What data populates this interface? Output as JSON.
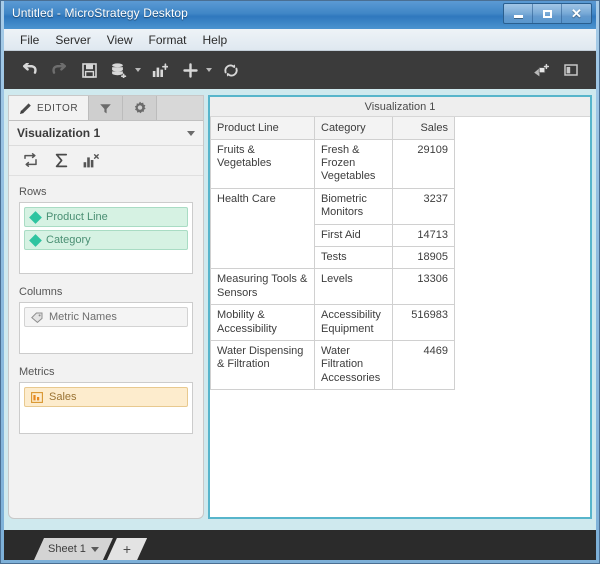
{
  "window": {
    "title": "Untitled - MicroStrategy Desktop",
    "buttons": {
      "minimize": "minimize",
      "maximize": "maximize",
      "close": "close"
    }
  },
  "menubar": {
    "items": [
      {
        "label": "File"
      },
      {
        "label": "Server"
      },
      {
        "label": "View"
      },
      {
        "label": "Format"
      },
      {
        "label": "Help"
      }
    ]
  },
  "toolbar": {
    "buttons": [
      {
        "name": "undo",
        "icon": "undo-arrow-icon",
        "enabled": true
      },
      {
        "name": "redo",
        "icon": "redo-arrow-icon",
        "enabled": false
      },
      {
        "name": "save",
        "icon": "save-disk-icon",
        "enabled": true
      },
      {
        "name": "add-data",
        "icon": "add-dataset-icon",
        "enabled": true,
        "caret": true
      },
      {
        "name": "add-visualization",
        "icon": "add-chart-icon",
        "enabled": true
      },
      {
        "name": "insert",
        "icon": "plus-icon",
        "enabled": true,
        "caret": true
      },
      {
        "name": "refresh",
        "icon": "refresh-icon",
        "enabled": true
      }
    ],
    "right_buttons": [
      {
        "name": "share",
        "icon": "share-add-icon"
      },
      {
        "name": "panel-toggle",
        "icon": "panel-icon"
      }
    ]
  },
  "editor": {
    "tabs": [
      {
        "name": "editor",
        "label": "EDITOR",
        "icon": "pencil-icon",
        "active": true
      },
      {
        "name": "filters",
        "label": "",
        "icon": "filter-funnel-icon",
        "active": false
      },
      {
        "name": "settings",
        "label": "",
        "icon": "gear-icon",
        "active": false
      }
    ],
    "visualization_selector": {
      "value": "Visualization 1",
      "icon": "chevron-down-icon"
    },
    "mini_toolbar": [
      {
        "name": "swap-rows-columns",
        "icon": "swap-arrows-icon"
      },
      {
        "name": "totals",
        "icon": "sigma-icon"
      },
      {
        "name": "remove-chart",
        "icon": "chart-remove-icon"
      }
    ],
    "shelves": [
      {
        "name": "rows",
        "title": "Rows",
        "items": [
          {
            "label": "Product Line",
            "kind": "attribute",
            "icon": "attribute-diamond-icon"
          },
          {
            "label": "Category",
            "kind": "attribute",
            "icon": "attribute-diamond-icon"
          }
        ]
      },
      {
        "name": "columns",
        "title": "Columns",
        "items": [
          {
            "label": "Metric Names",
            "kind": "metric-names",
            "icon": "metric-names-tag-icon"
          }
        ]
      },
      {
        "name": "metrics",
        "title": "Metrics",
        "items": [
          {
            "label": "Sales",
            "kind": "metric",
            "icon": "metric-bars-icon"
          }
        ]
      }
    ]
  },
  "visualization": {
    "title": "Visualization 1",
    "grid": {
      "columns": [
        {
          "key": "product_line",
          "label": "Product Line",
          "align": "left"
        },
        {
          "key": "category",
          "label": "Category",
          "align": "left"
        },
        {
          "key": "sales",
          "label": "Sales",
          "align": "right"
        }
      ],
      "rows": [
        {
          "product_line": "Fruits & Vegetables",
          "product_line_rowspan": 1,
          "category": "Fresh & Frozen Vegetables",
          "sales": "29109"
        },
        {
          "product_line": "Health Care",
          "product_line_rowspan": 3,
          "category": "Biometric Monitors",
          "sales": "3237"
        },
        {
          "product_line": "",
          "product_line_rowspan": 0,
          "category": "First Aid",
          "sales": "14713"
        },
        {
          "product_line": "",
          "product_line_rowspan": 0,
          "category": "Tests",
          "sales": "18905"
        },
        {
          "product_line": "Measuring Tools & Sensors",
          "product_line_rowspan": 1,
          "category": "Levels",
          "sales": "13306"
        },
        {
          "product_line": "Mobility & Accessibility",
          "product_line_rowspan": 1,
          "category": "Accessibility Equipment",
          "sales": "516983"
        },
        {
          "product_line": "Water Dispensing & Filtration",
          "product_line_rowspan": 1,
          "category": "Water Filtration Accessories",
          "sales": "4469"
        }
      ]
    }
  },
  "sheetbar": {
    "tabs": [
      {
        "name": "sheet-1",
        "label": "Sheet 1",
        "active": true,
        "has_caret": true
      }
    ],
    "add_label": "+"
  },
  "colors": {
    "titlebar_accent": "#3f86c6",
    "viz_border": "#57b5cb",
    "attribute_pill": "#d6f2e3",
    "attribute_text": "#4a8f73",
    "metric_pill": "#fdeccd",
    "metric_text": "#9a7333",
    "toolbar_bg": "#3b3b3b",
    "canvas_bg": "#cfe9ee"
  }
}
